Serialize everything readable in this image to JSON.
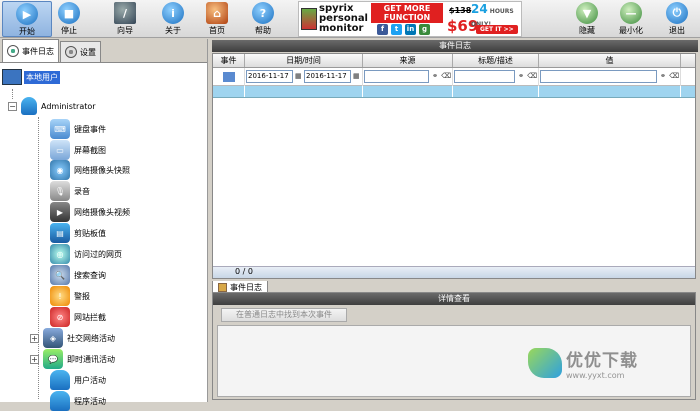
{
  "toolbar": {
    "start": "开始",
    "stop": "停止",
    "wizard": "向导",
    "about": "关于",
    "home": "首页",
    "help": "帮助",
    "hide": "隐藏",
    "minimize": "最小化",
    "exit": "退出"
  },
  "ad": {
    "brand_line1": "spyrix",
    "brand_line2": "personal",
    "brand_line3": "monitor",
    "get_more_line1": "GET MORE",
    "get_more_line2": "FUNCTION",
    "old_price": "$138",
    "new_price": "$69",
    "hours_num": "24",
    "hours_text": "HOURS",
    "only_text": "ONLY!",
    "get_it": "GET IT >>",
    "social": [
      "f",
      "t",
      "in",
      "g"
    ]
  },
  "left": {
    "tabs": [
      "事件日志",
      "设置"
    ],
    "local_user": "本地用户",
    "root_user": "Administrator",
    "items": [
      "键盘事件",
      "屏幕截图",
      "网络摄像头快照",
      "录音",
      "网络摄像头视频",
      "剪贴板值",
      "访问过的网页",
      "搜索查询",
      "警报",
      "网站拦截",
      "社交网络活动",
      "即时通讯活动",
      "用户活动",
      "程序活动"
    ]
  },
  "events": {
    "panel_title": "事件日志",
    "columns": [
      "事件",
      "日期/时间",
      "来源",
      "标题/描述",
      "值"
    ],
    "date_from": "2016-11-17",
    "date_to": "2016-11-17",
    "count": "0 / 0",
    "tab": "事件日志"
  },
  "detail": {
    "panel_title": "详情查看",
    "find_button": "在普通日志中找到本次事件"
  },
  "watermark": {
    "title": "优优下载",
    "url": "www.yyxt.com"
  },
  "colors": {
    "selection": "#9fd4ef",
    "accent": "#2e6ad6",
    "ad_red": "#e02020"
  }
}
